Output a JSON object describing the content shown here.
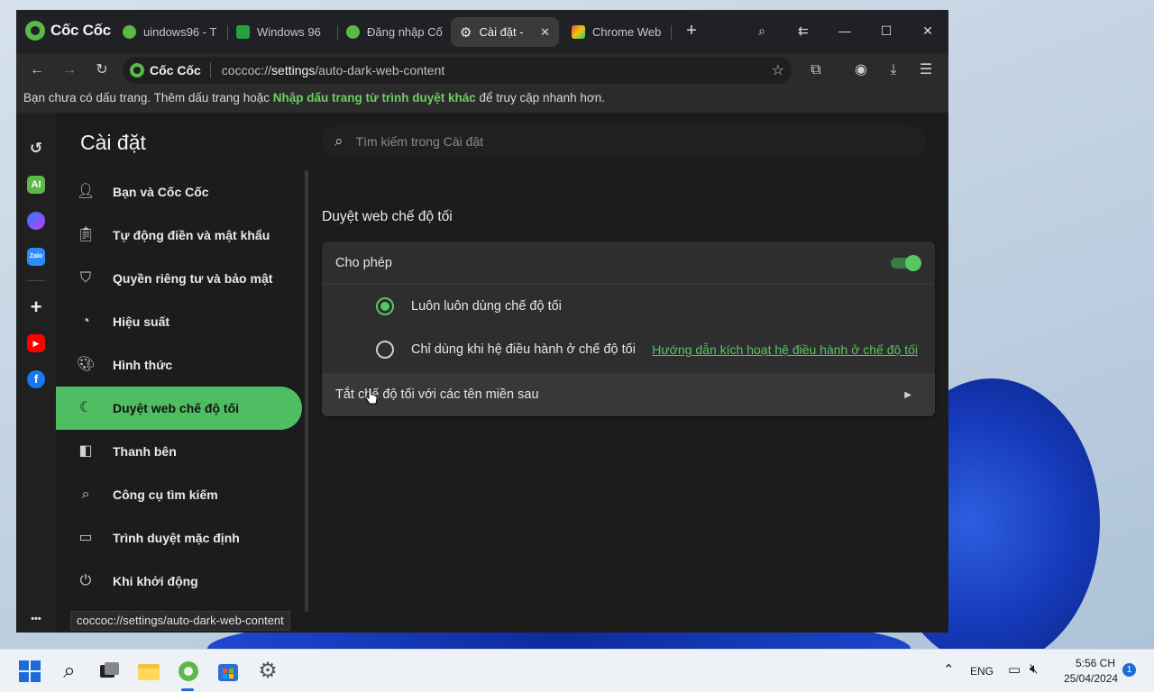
{
  "browser": {
    "brand": "Cốc Cốc",
    "tabs": [
      {
        "label": "uindows96 - T",
        "active": false
      },
      {
        "label": "Windows 96",
        "active": false
      },
      {
        "label": "Đăng nhập Cố",
        "active": false
      },
      {
        "label": "Cài đặt -",
        "active": true
      },
      {
        "label": "Chrome Web",
        "active": false
      }
    ],
    "new_tab": "+",
    "address": {
      "badge": "Cốc Cốc",
      "url_prefix": "coccoc://",
      "url_host": "settings",
      "url_path": "/auto-dark-web-content"
    },
    "bookmark_bar": {
      "text_before": "Bạn chưa có dấu trang. Thêm dấu trang hoặc ",
      "link": "Nhập dấu trang từ trình duyệt khác",
      "text_after": " để truy cập nhanh hơn."
    },
    "status_url": "coccoc://settings/auto-dark-web-content"
  },
  "sidestrip": {
    "ai_label": "AI",
    "zalo_label": "Zalo",
    "more": "•••"
  },
  "settings": {
    "title": "Cài đặt",
    "search_placeholder": "Tìm kiếm trong Cài đặt",
    "nav": [
      {
        "label": "Bạn và Cốc Cốc",
        "icon": "person-icon"
      },
      {
        "label": "Tự động điền và mật khẩu",
        "icon": "clipboard-icon"
      },
      {
        "label": "Quyền riêng tư và bảo mật",
        "icon": "shield-icon"
      },
      {
        "label": "Hiệu suất",
        "icon": "speedometer-icon"
      },
      {
        "label": "Hình thức",
        "icon": "palette-icon"
      },
      {
        "label": "Duyệt web chế độ tối",
        "icon": "moon-icon",
        "active": true
      },
      {
        "label": "Thanh bên",
        "icon": "sidebar-icon"
      },
      {
        "label": "Công cụ tìm kiếm",
        "icon": "search-icon"
      },
      {
        "label": "Trình duyệt mặc định",
        "icon": "browser-icon"
      },
      {
        "label": "Khi khởi động",
        "icon": "power-icon"
      }
    ],
    "section_title": "Duyệt web chế độ tối",
    "allow_label": "Cho phép",
    "allow_enabled": true,
    "option_always": "Luôn luôn dùng chế độ tối",
    "option_os": "Chỉ dùng khi hệ điều hành ở chế độ tối",
    "os_help_link": "Hướng dẫn kích hoạt hệ điều hành ở chế độ tối",
    "selected_option": "always",
    "exclusions_label": "Tắt chế độ tối với các tên miền sau"
  },
  "taskbar": {
    "lang": "ENG",
    "time": "5:56 CH",
    "date": "25/04/2024",
    "notification_count": "1"
  },
  "colors": {
    "accent": "#4fbe63",
    "window_bg": "#1c1c1c",
    "card_bg": "#2e2e2e"
  }
}
